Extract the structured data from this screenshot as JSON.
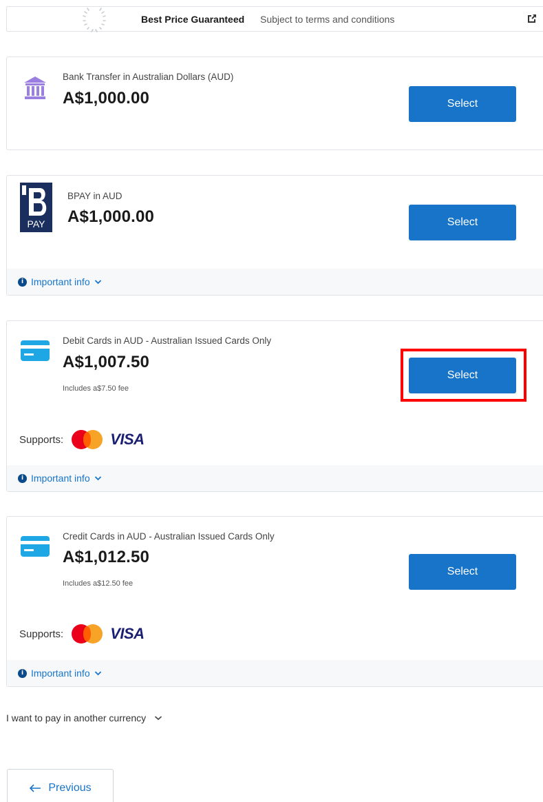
{
  "banner": {
    "title": "Best Price Guaranteed",
    "subtitle": "Subject to terms and conditions",
    "icon": "external-link-icon"
  },
  "options": [
    {
      "icon": "bank-icon",
      "label": "Bank Transfer in Australian Dollars (AUD)",
      "amount": "A$1,000.00",
      "button": "Select"
    },
    {
      "icon": "bpay-logo",
      "logo_text": "PAY",
      "label": "BPAY in AUD",
      "amount": "A$1,000.00",
      "button": "Select",
      "info": "Important info"
    },
    {
      "icon": "card-icon",
      "label": "Debit Cards in AUD - Australian Issued Cards Only",
      "amount": "A$1,007.50",
      "fee": "Includes a$7.50 fee",
      "button": "Select",
      "supports_label": "Supports:",
      "brands": [
        "mastercard",
        "VISA"
      ],
      "info": "Important info"
    },
    {
      "icon": "card-icon",
      "label": "Credit Cards in AUD - Australian Issued Cards Only",
      "amount": "A$1,012.50",
      "fee": "Includes a$12.50 fee",
      "button": "Select",
      "supports_label": "Supports:",
      "brands": [
        "mastercard",
        "VISA"
      ],
      "info": "Important info"
    }
  ],
  "other_currency": "I want to pay in another currency",
  "previous": "Previous",
  "colors": {
    "primary": "#1774c9",
    "highlight": "#ff0000",
    "bank_icon": "#9b7fe0",
    "card_icon": "#1ea7e4",
    "bpay_logo": "#1b2f5e"
  }
}
